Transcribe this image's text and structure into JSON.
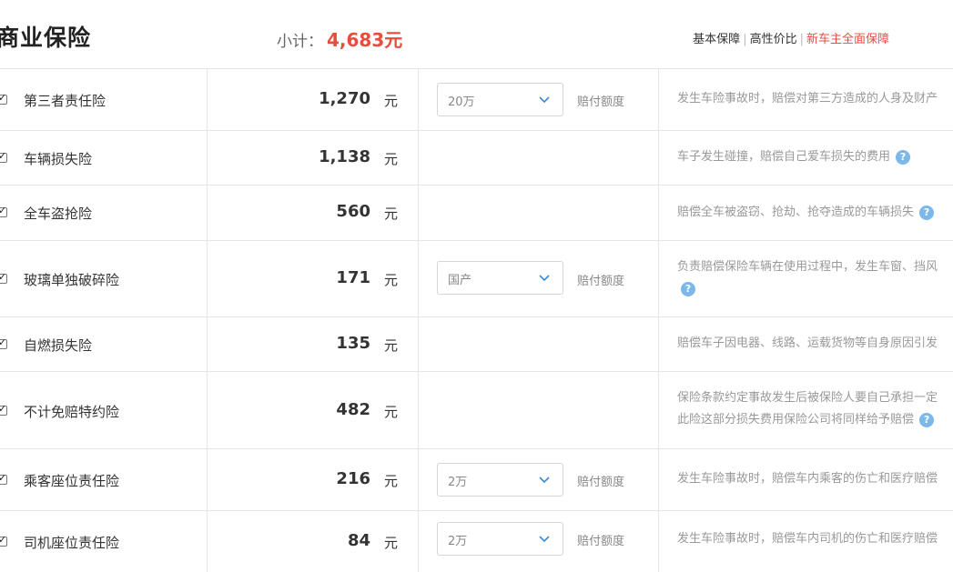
{
  "header": {
    "title": "商业保险",
    "subtotal_label": "小计：",
    "subtotal_value": "4,683元",
    "plans": [
      "基本保障",
      "高性价比",
      "新车主全面保障"
    ]
  },
  "rows": [
    {
      "name": "第三者责任险",
      "price": "1,270",
      "unit": "元",
      "select": "20万",
      "limit_label": "赔付额度",
      "desc": [
        "发生车险事故时，赔偿对第三方造成的人身及财产"
      ]
    },
    {
      "name": "车辆损失险",
      "price": "1,138",
      "unit": "元",
      "desc": [
        "车子发生碰撞，赔偿自己爱车损失的费用"
      ]
    },
    {
      "name": "全车盗抢险",
      "price": "560",
      "unit": "元",
      "desc": [
        "赔偿全车被盗窃、抢劫、抢夺造成的车辆损失"
      ]
    },
    {
      "name": "玻璃单独破碎险",
      "price": "171",
      "unit": "元",
      "select": "国产",
      "limit_label": "赔付额度",
      "desc": [
        "负责赔偿保险车辆在使用过程中，发生车窗、挡风",
        ""
      ]
    },
    {
      "name": "自燃损失险",
      "price": "135",
      "unit": "元",
      "desc": [
        "赔偿车子因电器、线路、运载货物等自身原因引发"
      ]
    },
    {
      "name": "不计免赔特约险",
      "price": "482",
      "unit": "元",
      "desc": [
        "保险条款约定事故发生后被保险人要自己承担一定",
        "此险这部分损失费用保险公司将同样给予赔偿"
      ]
    },
    {
      "name": "乘客座位责任险",
      "price": "216",
      "unit": "元",
      "select": "2万",
      "limit_label": "赔付额度",
      "desc": [
        "发生车险事故时，赔偿车内乘客的伤亡和医疗赔偿"
      ]
    },
    {
      "name": "司机座位责任险",
      "price": "84",
      "unit": "元",
      "select": "2万",
      "limit_label": "赔付额度",
      "desc": [
        "发生车险事故时，赔偿车内司机的伤亡和医疗赔偿"
      ]
    }
  ],
  "icons": {
    "help": "question-circle-icon",
    "dropdown": "chevron-down-icon",
    "check": "checkbox-checked-icon"
  },
  "colors": {
    "accent_red": "#e84c3d",
    "help_blue": "#7cb8ea",
    "border": "#e5e5e5",
    "muted_text": "#999999"
  },
  "help_glyph": "?"
}
